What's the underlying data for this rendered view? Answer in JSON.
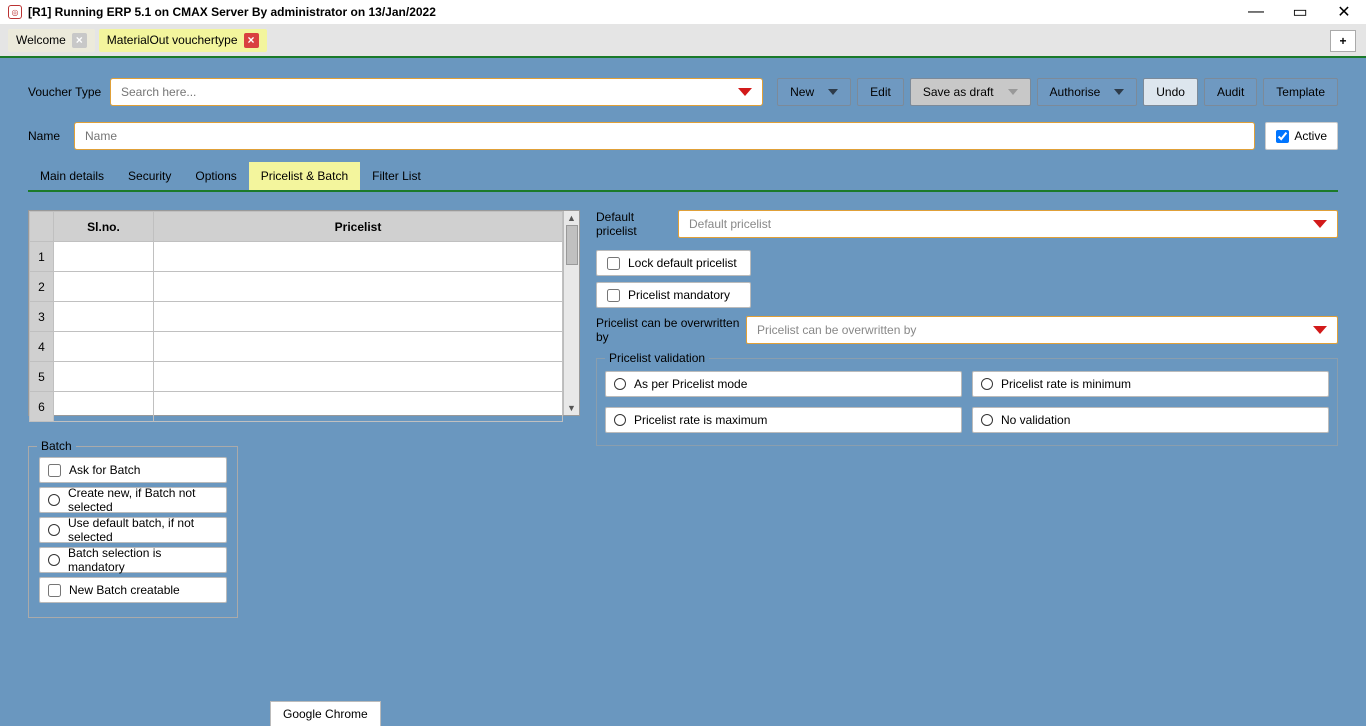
{
  "window": {
    "title": "[R1] Running ERP 5.1 on CMAX Server By administrator on 13/Jan/2022"
  },
  "tabs": {
    "inactive": "Welcome",
    "active": "MaterialOut vouchertype",
    "add": "+"
  },
  "toolbar": {
    "voucher_label": "Voucher Type",
    "search_placeholder": "Search here...",
    "new": "New",
    "edit": "Edit",
    "save_draft": "Save as draft",
    "authorise": "Authorise",
    "undo": "Undo",
    "audit": "Audit",
    "template": "Template"
  },
  "name_row": {
    "label": "Name",
    "placeholder": "Name",
    "active": "Active"
  },
  "subtabs": {
    "main": "Main details",
    "security": "Security",
    "options": "Options",
    "pricelist": "Pricelist & Batch",
    "filter": "Filter List"
  },
  "table": {
    "col_slno": "Sl.no.",
    "col_pricelist": "Pricelist",
    "rows": [
      "1",
      "2",
      "3",
      "4",
      "5",
      "6"
    ]
  },
  "batch": {
    "legend": "Batch",
    "ask": "Ask for Batch",
    "create": "Create new, if Batch not selected",
    "use_default": "Use default batch, if not selected",
    "mandatory": "Batch selection is mandatory",
    "new_creatable": "New Batch creatable"
  },
  "right": {
    "default_pl_label": "Default pricelist",
    "default_pl_placeholder": "Default pricelist",
    "lock": "Lock default pricelist",
    "mandatory": "Pricelist  mandatory",
    "overwrite_label": "Pricelist can be overwritten by",
    "overwrite_placeholder": "Pricelist can be overwritten by",
    "validation_legend": "Pricelist validation",
    "opt1": "As per Pricelist mode",
    "opt2": "Pricelist rate is minimum",
    "opt3": "Pricelist rate is maximum",
    "opt4": "No validation"
  },
  "taskbar": {
    "chrome": "Google Chrome"
  }
}
